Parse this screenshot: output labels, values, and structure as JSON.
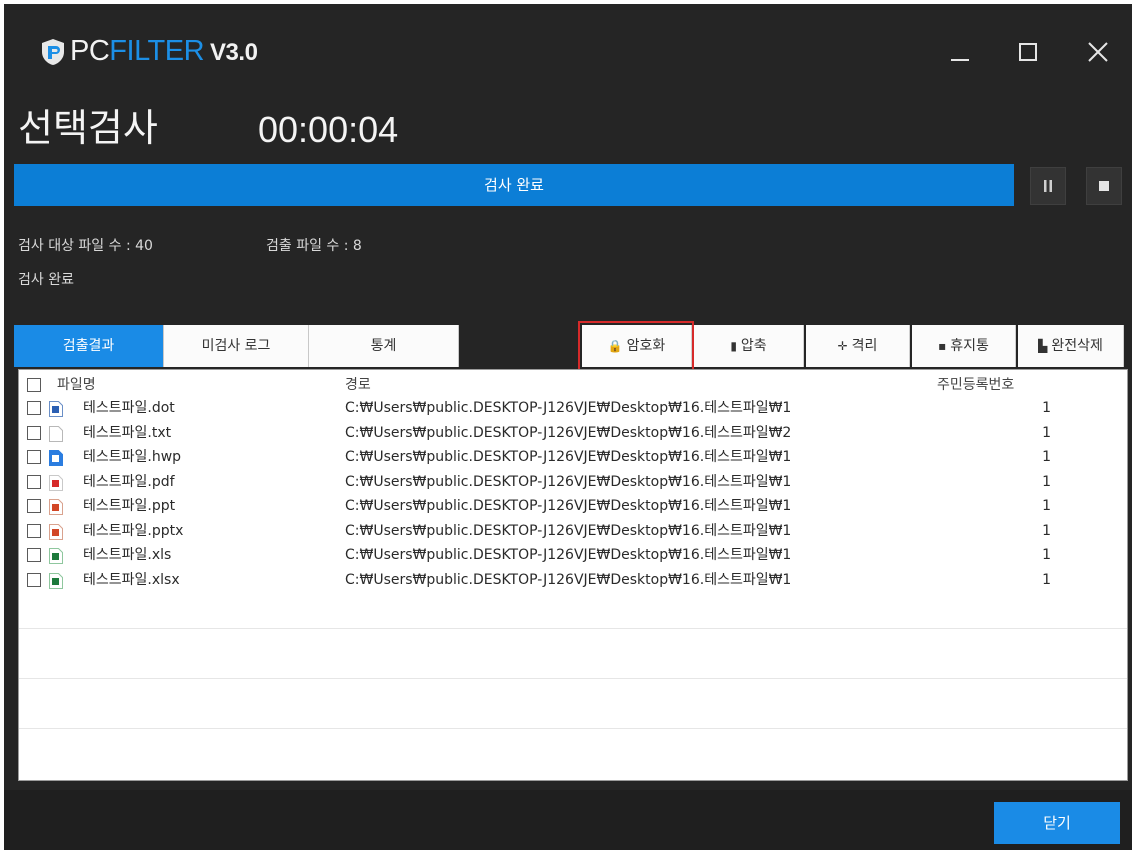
{
  "window": {
    "brand_pc": "PC",
    "brand_filter": "FILTER",
    "version": "V3.0",
    "controls": [
      "minimize-icon",
      "maximize-icon",
      "close-icon"
    ]
  },
  "header": {
    "mode": "선택검사",
    "elapsed": "00:00:04"
  },
  "progress": {
    "label": "검사 완료",
    "percent": 100,
    "pause_icon": "pause-icon",
    "stop_icon": "stop-icon"
  },
  "stats": {
    "target_files": "검사 대상 파일 수 : 40",
    "detected_files": "검출 파일 수 : 8",
    "status": "검사 완료"
  },
  "tabs": [
    {
      "label": "검출결과",
      "active": true
    },
    {
      "label": "미검사 로그",
      "active": false
    },
    {
      "label": "통계",
      "active": false
    }
  ],
  "actions": [
    {
      "label": "암호화",
      "icon": "lock-icon"
    },
    {
      "label": "압축",
      "icon": "archive-icon"
    },
    {
      "label": "격리",
      "icon": "move-icon"
    },
    {
      "label": "휴지통",
      "icon": "trash-icon"
    },
    {
      "label": "완전삭제",
      "icon": "shred-icon"
    }
  ],
  "table": {
    "columns": {
      "name": "파일명",
      "path": "경로",
      "rrn": "주민등록번호"
    },
    "rows": [
      {
        "name": "테스트파일.dot",
        "path": "C:₩Users₩public.DESKTOP-J126VJE₩Desktop₩16.테스트파일₩1",
        "count": "1",
        "icon": "word-template-icon"
      },
      {
        "name": "테스트파일.txt",
        "path": "C:₩Users₩public.DESKTOP-J126VJE₩Desktop₩16.테스트파일₩2",
        "count": "1",
        "icon": "text-file-icon"
      },
      {
        "name": "테스트파일.hwp",
        "path": "C:₩Users₩public.DESKTOP-J126VJE₩Desktop₩16.테스트파일₩1",
        "count": "1",
        "icon": "hwp-file-icon"
      },
      {
        "name": "테스트파일.pdf",
        "path": "C:₩Users₩public.DESKTOP-J126VJE₩Desktop₩16.테스트파일₩1",
        "count": "1",
        "icon": "pdf-file-icon"
      },
      {
        "name": "테스트파일.ppt",
        "path": "C:₩Users₩public.DESKTOP-J126VJE₩Desktop₩16.테스트파일₩1",
        "count": "1",
        "icon": "ppt-file-icon"
      },
      {
        "name": "테스트파일.pptx",
        "path": "C:₩Users₩public.DESKTOP-J126VJE₩Desktop₩16.테스트파일₩1",
        "count": "1",
        "icon": "pptx-file-icon"
      },
      {
        "name": "테스트파일.xls",
        "path": "C:₩Users₩public.DESKTOP-J126VJE₩Desktop₩16.테스트파일₩1",
        "count": "1",
        "icon": "xls-file-icon"
      },
      {
        "name": "테스트파일.xlsx",
        "path": "C:₩Users₩public.DESKTOP-J126VJE₩Desktop₩16.테스트파일₩1",
        "count": "1",
        "icon": "xlsx-file-icon"
      }
    ]
  },
  "footer": {
    "close_label": "닫기"
  },
  "colors": {
    "accent": "#1a8be6",
    "brand_filter": "#1c8fe6",
    "window_bg": "#252525",
    "highlight": "#d62a2a"
  }
}
